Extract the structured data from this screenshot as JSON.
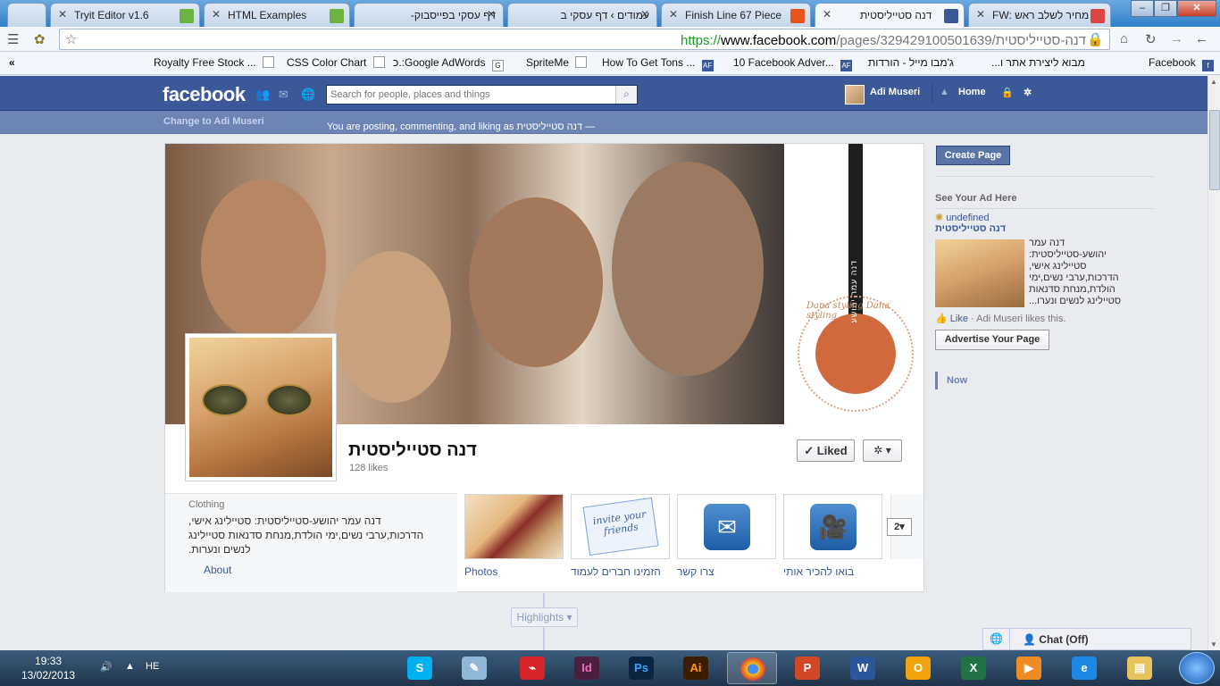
{
  "browser": {
    "tabs": [
      {
        "title": "",
        "fav": "#ddd"
      },
      {
        "title": "Tryit Editor v1.6",
        "fav": "#6db33f"
      },
      {
        "title": "HTML Examples",
        "fav": "#6db33f"
      },
      {
        "title": "דף עסקי בפייסבוק-",
        "fav": "#bbb"
      },
      {
        "title": "עמודים › דף עסקי ב",
        "fav": "#bbb"
      },
      {
        "title": "Finish Line 67 Piece",
        "fav": "#e8541c"
      },
      {
        "title": "דנה סטייליסטית",
        "fav": "#3b5998"
      },
      {
        "title": "FW: מחיר לשלב ראש",
        "fav": "#d44"
      }
    ],
    "url": {
      "scheme": "https://",
      "host": "www.facebook.com",
      "path": "/pages/דנה-סטייליסטית/329429100501639"
    },
    "bookmarks": [
      "Royalty Free Stock ...",
      "CSS Color Chart",
      "כ.:Google AdWords",
      "SpriteMe",
      "How To Get Tons ...",
      "10 Facebook Adver...",
      "ג'מבו מייל - הורדות",
      "מבוא ליצירת אתר ו...",
      "Facebook"
    ]
  },
  "fb": {
    "logo": "facebook",
    "search_placeholder": "Search for people, places and things",
    "user_name": "Adi Museri",
    "home": "Home",
    "posting_as": "You are posting, commenting, and liking as דנה סטייליסטית —",
    "change_to": "Change to Adi Museri"
  },
  "page": {
    "name": "דנה סטייליסטית",
    "likes": "128 likes",
    "liked_btn": "Liked",
    "brand_ring": "Dana styling Dana styling",
    "brand_vertical": "דנה עמר יהושע",
    "about_category": "Clothing",
    "about_text": "דנה עמר יהושע-סטייליסטית: סטיילינג אישי, הדרכות,ערבי נשים,ימי הולדת,מנחת סדנאות סטיילינג לנשים ונערות.",
    "about_link": "About",
    "apps": [
      {
        "label": "Photos"
      },
      {
        "label": "הזמינו חברים לעמוד",
        "art": "invite your friends"
      },
      {
        "label": "צרו קשר"
      },
      {
        "label": "בואו להכיר אותי"
      }
    ],
    "more_count": "2",
    "highlights": "Highlights"
  },
  "sidebar": {
    "create_page": "Create Page",
    "see_ad": "See Your Ad Here",
    "ad_undefined": "undefined",
    "ad_title": "דנה סטייליסטית",
    "ad_text": "דנה עמר יהושע-סטייליסטית: סטיילינג אישי, הדרכות,ערבי נשים,ימי הולדת,מנחת סדנאות סטיילינג לנשים ונערו...",
    "ad_like": "Like",
    "ad_like_who": "· Adi Museri likes this.",
    "advertise": "Advertise Your Page",
    "now": "Now"
  },
  "chat": {
    "label": "Chat (Off)"
  },
  "taskbar": {
    "time": "19:33",
    "date": "13/02/2013",
    "lang": "HE"
  }
}
